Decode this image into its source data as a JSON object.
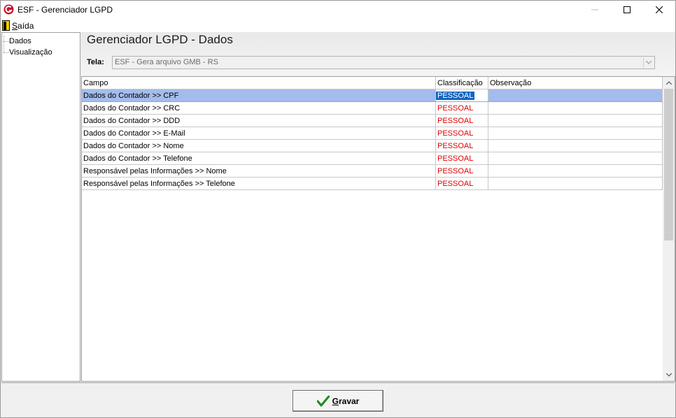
{
  "window": {
    "title": "ESF - Gerenciador LGPD"
  },
  "menu": {
    "exit_label_first": "S",
    "exit_label_rest": "aída"
  },
  "tree": {
    "items": [
      "Dados",
      "Visualização"
    ]
  },
  "header": {
    "title": "Gerenciador LGPD - Dados",
    "tela_label": "Tela:",
    "tela_value": "ESF - Gera arquivo GMB - RS"
  },
  "grid": {
    "columns": [
      "Campo",
      "Classificação",
      "Observação"
    ],
    "rows": [
      {
        "campo": "Dados do Contador >> CPF",
        "classificacao": "PESSOAL",
        "observacao": ""
      },
      {
        "campo": "Dados do Contador >> CRC",
        "classificacao": "PESSOAL",
        "observacao": ""
      },
      {
        "campo": "Dados do Contador >> DDD",
        "classificacao": "PESSOAL",
        "observacao": ""
      },
      {
        "campo": "Dados do Contador >> E-Mail",
        "classificacao": "PESSOAL",
        "observacao": ""
      },
      {
        "campo": "Dados do Contador >> Nome",
        "classificacao": "PESSOAL",
        "observacao": ""
      },
      {
        "campo": "Dados do Contador >> Telefone",
        "classificacao": "PESSOAL",
        "observacao": ""
      },
      {
        "campo": "Responsável pelas Informações >> Nome",
        "classificacao": "PESSOAL",
        "observacao": ""
      },
      {
        "campo": "Responsável pelas Informações >> Telefone",
        "classificacao": "PESSOAL",
        "observacao": ""
      }
    ]
  },
  "footer": {
    "save_label_first": "G",
    "save_label_rest": "ravar"
  },
  "colors": {
    "classification_text": "#e00000",
    "selected_row": "#a3bcec",
    "selected_cell": "#1565c0",
    "save_check": "#1e8a1e"
  }
}
